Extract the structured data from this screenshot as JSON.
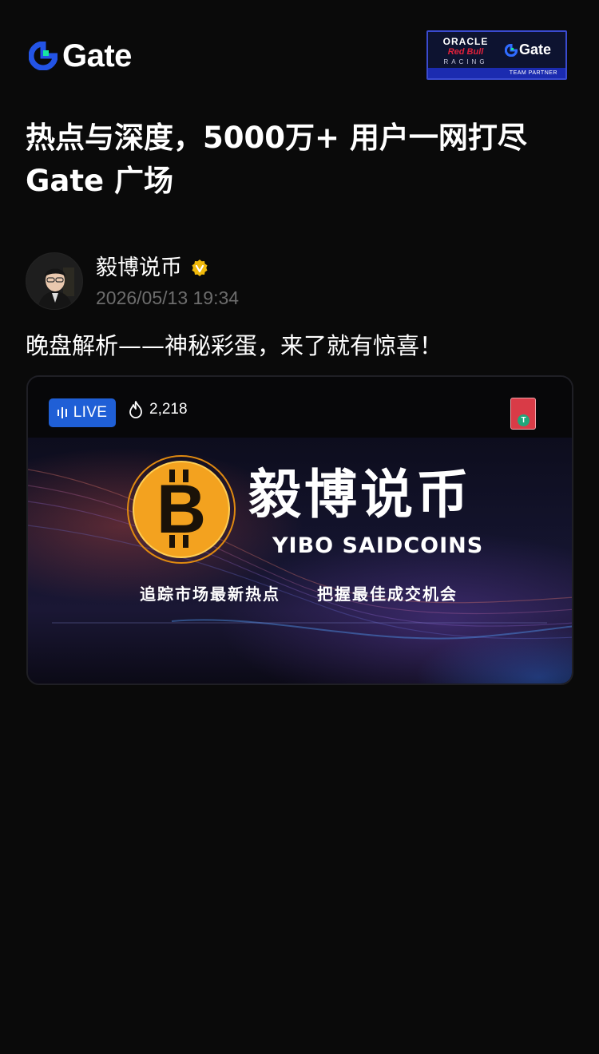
{
  "header": {
    "brand_name": "Gate",
    "partner": {
      "oracle": "ORACLE",
      "redbull": "Red Bull",
      "racing": "RACING",
      "gate": "Gate",
      "strip": "TEAM PARTNER"
    }
  },
  "headline": {
    "line1": "热点与深度，5000万+ 用户一网打尽",
    "line2": "Gate 广场"
  },
  "post": {
    "author_name": "毅博说币",
    "verified_icon": "verified-badge-icon",
    "timestamp": "2026/05/13 19:34",
    "text": "晚盘解析——神秘彩蛋，来了就有惊喜！"
  },
  "live": {
    "badge_label": "LIVE",
    "viewers": "2,218",
    "banner_title": "毅博说币",
    "banner_subtitle": "YIBO SAIDCOINS",
    "tagline_left": "追踪市场最新热点",
    "tagline_right": "把握最佳成交机会",
    "badge_color": "#1f5fd6"
  },
  "colors": {
    "background": "#0a0a0a",
    "brand_blue": "#2354e6",
    "brand_green": "#17e6a1",
    "muted_text": "#6d6d6d",
    "verified": "#f0b90b"
  }
}
